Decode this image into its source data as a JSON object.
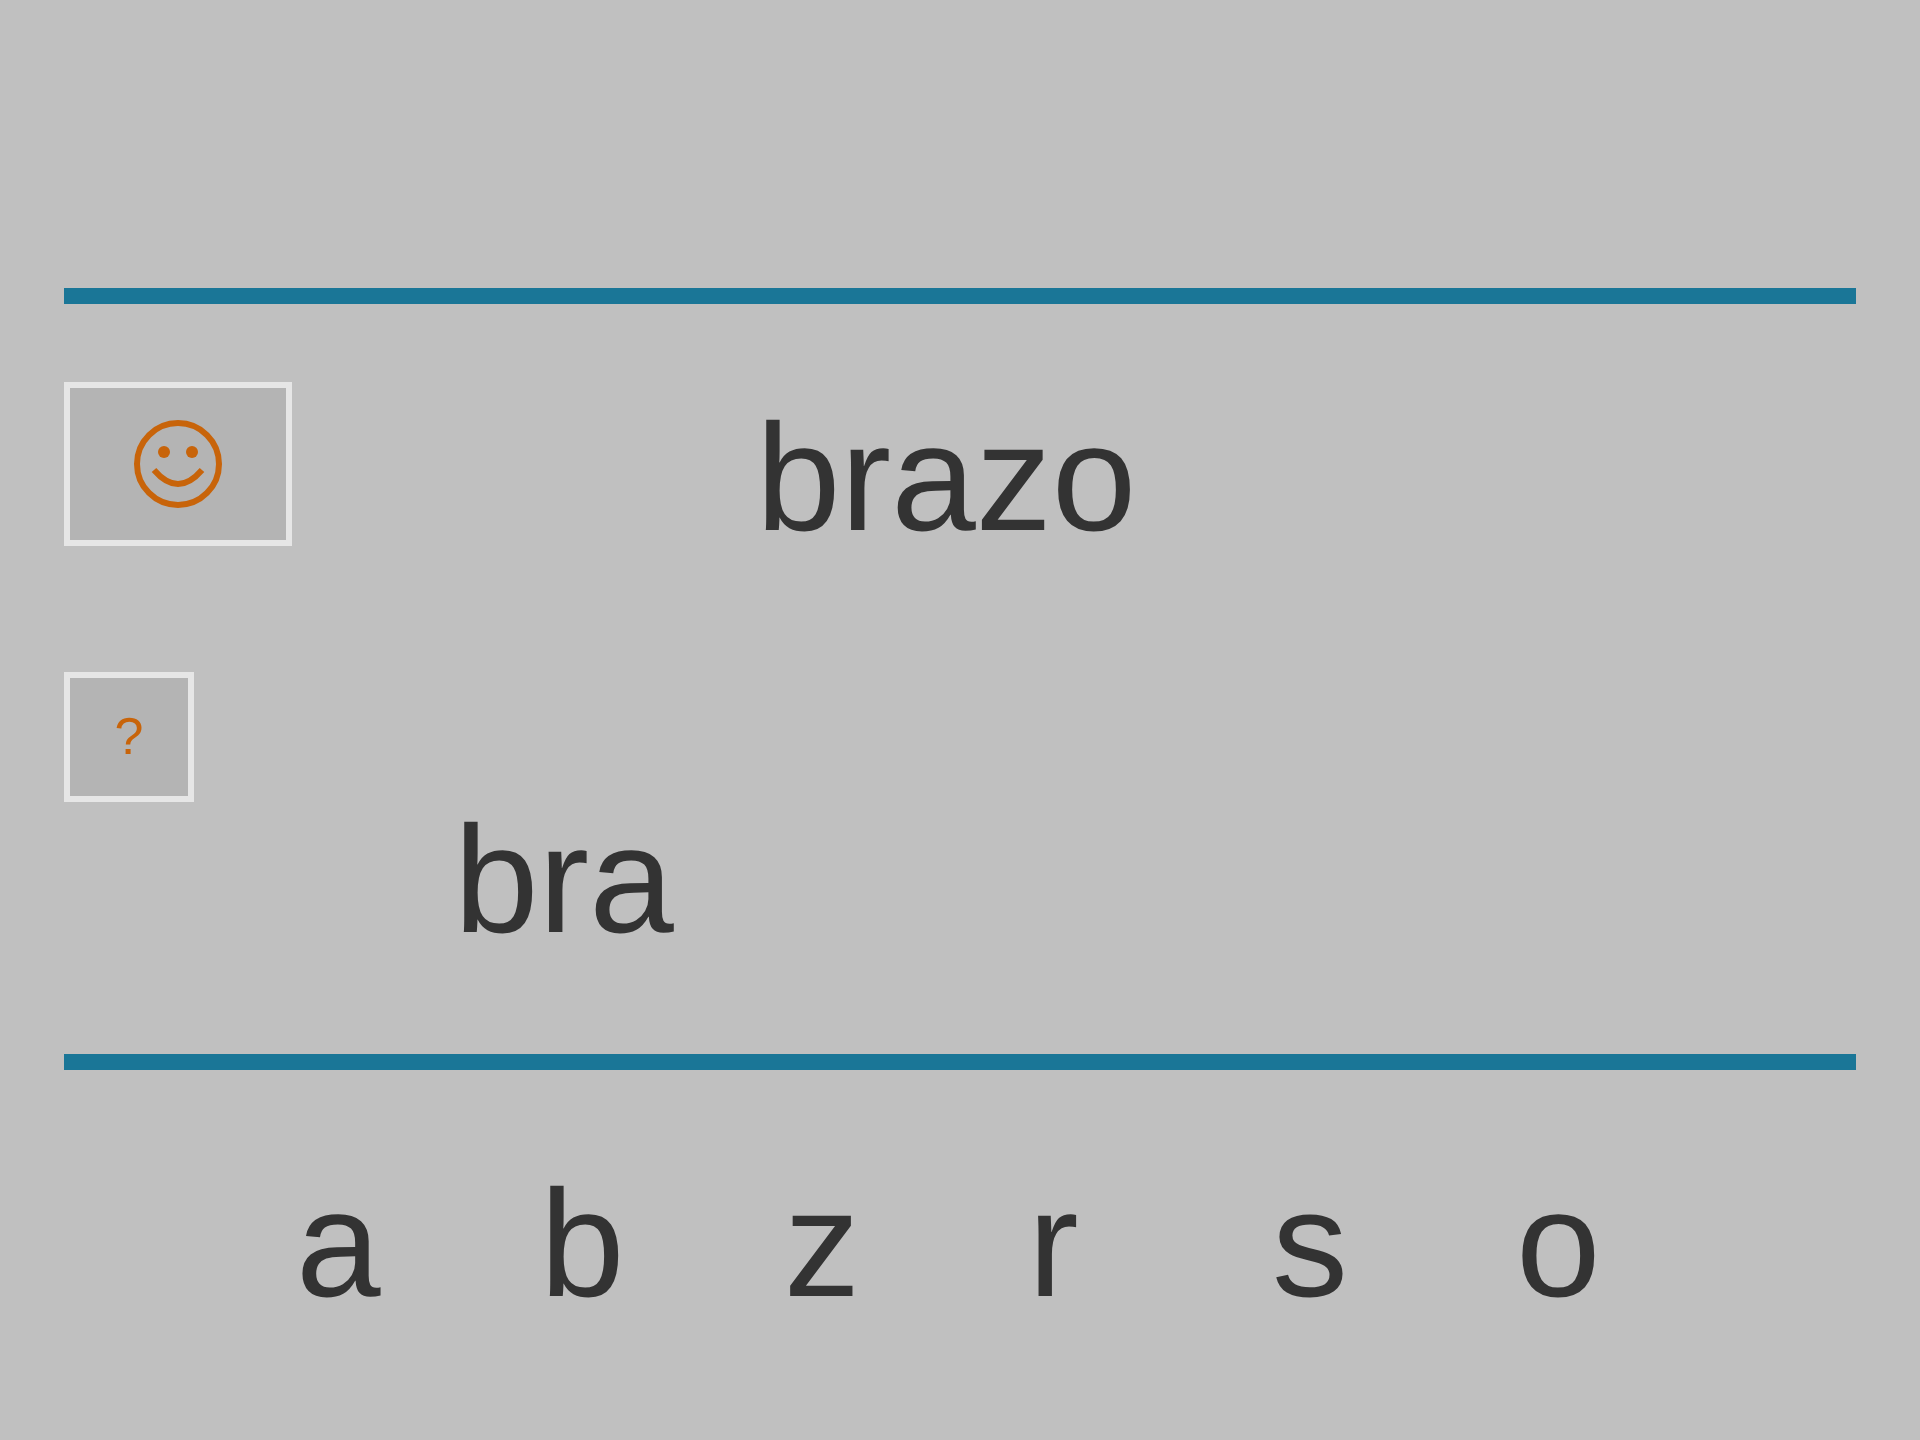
{
  "word": "brazo",
  "hint_button": "?",
  "answer": "bra",
  "letters": [
    "a",
    "b",
    "z",
    "r",
    "s",
    "o"
  ]
}
